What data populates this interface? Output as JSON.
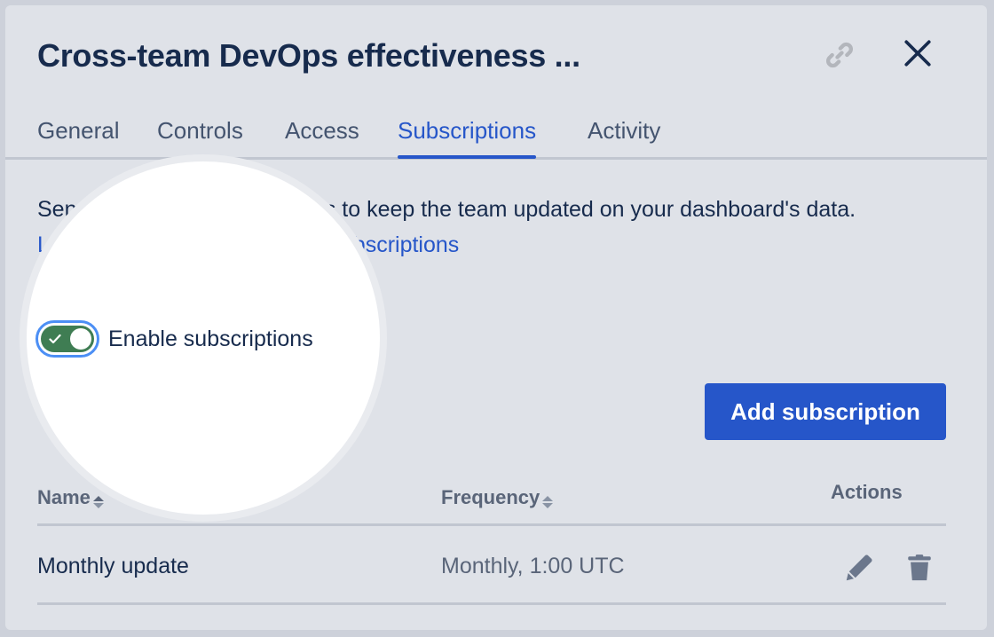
{
  "modal": {
    "title": "Cross-team DevOps effectiveness ...",
    "link_icon": "link-icon",
    "close_icon": "close-icon"
  },
  "tabs": [
    {
      "label": "General",
      "active": false
    },
    {
      "label": "Controls",
      "active": false
    },
    {
      "label": "Access",
      "active": false
    },
    {
      "label": "Subscriptions",
      "active": true
    },
    {
      "label": "Activity",
      "active": false
    }
  ],
  "subscriptions": {
    "description": "Send dashboard subscriptions to keep the team updated on your dashboard's data.",
    "learn_more_link": "Learn more about dashboard subscriptions",
    "toggle": {
      "label": "Enable subscriptions",
      "checked": true,
      "check_icon": "check-icon"
    },
    "add_button": "Add subscription",
    "table": {
      "columns": [
        {
          "label": "Name",
          "sortable": true
        },
        {
          "label": "Frequency",
          "sortable": true
        },
        {
          "label": "Actions",
          "sortable": false
        }
      ],
      "rows": [
        {
          "name": "Monthly update",
          "frequency": "Monthly, 1:00 UTC",
          "actions": [
            "edit-icon",
            "delete-icon"
          ]
        }
      ]
    }
  },
  "colors": {
    "accent": "#2656c9",
    "toggle_on": "#3f7d53",
    "focus_ring": "#4c8ff5",
    "text_primary": "#172b4d",
    "text_secondary": "#44546f",
    "background": "#dfe2e8"
  }
}
